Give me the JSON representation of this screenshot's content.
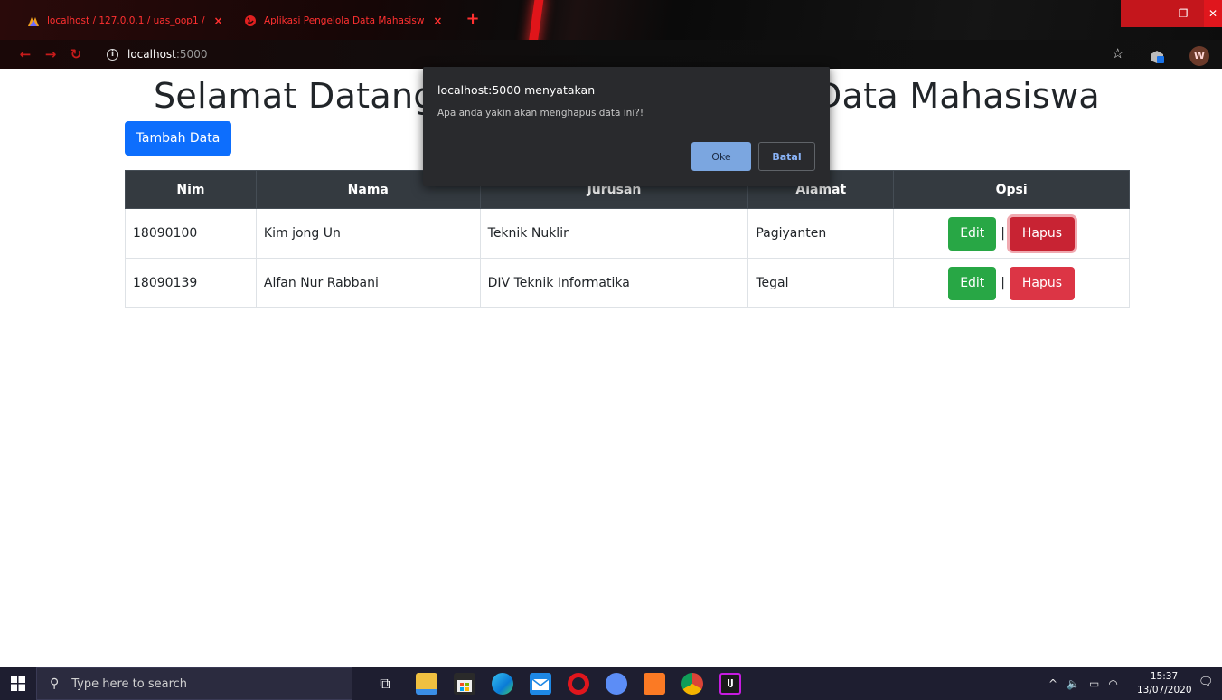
{
  "browser": {
    "tabs": [
      {
        "label": "localhost / 127.0.0.1 / uas_oop1 /",
        "close": "×"
      },
      {
        "label": "Aplikasi Pengelola Data Mahasisw",
        "close": "×"
      }
    ],
    "new_tab": "+",
    "url_host": "localhost",
    "url_port": ":5000",
    "avatar_letter": "W",
    "window": {
      "minimize": "—",
      "maximize": "❐",
      "close": "✕"
    }
  },
  "page": {
    "title": "Selamat Datang di Aplikasi Pengelola Data Mahasiswa",
    "add_button": "Tambah Data",
    "table": {
      "headers": [
        "Nim",
        "Nama",
        "Jurusan",
        "Alamat",
        "Opsi"
      ],
      "rows": [
        {
          "nim": "18090100",
          "nama": "Kim jong Un",
          "jurusan": "Teknik Nuklir",
          "alamat": "Pagiyanten"
        },
        {
          "nim": "18090139",
          "nama": "Alfan Nur Rabbani",
          "jurusan": "DIV Teknik Informatika",
          "alamat": "Tegal"
        }
      ],
      "edit_label": "Edit",
      "separator": "|",
      "delete_label": "Hapus"
    }
  },
  "dialog": {
    "title": "localhost:5000 menyatakan",
    "message": "Apa anda yakin akan menghapus data ini?!",
    "ok_label": "Oke",
    "cancel_label": "Batal"
  },
  "taskbar": {
    "search_placeholder": "Type here to search",
    "time": "15:37",
    "date": "13/07/2020"
  },
  "colors": {
    "primary": "#0d6efd",
    "success": "#28a745",
    "danger": "#dc3545",
    "table_header": "#343a40"
  }
}
